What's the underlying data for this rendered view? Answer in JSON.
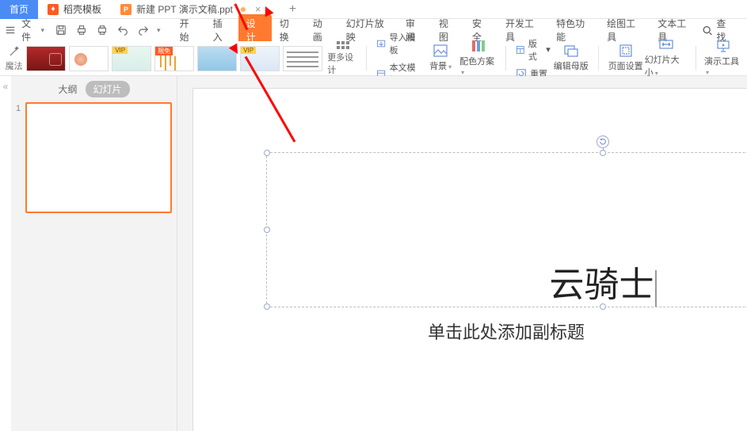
{
  "tabs": {
    "home": "首页",
    "docer": "稻壳模板",
    "file": "新建 PPT 演示文稿.ppt"
  },
  "file_menu": "文件",
  "menus": [
    "开始",
    "插入",
    "设计",
    "切换",
    "动画",
    "幻灯片放映",
    "审阅",
    "视图",
    "安全",
    "开发工具",
    "特色功能",
    "绘图工具",
    "文本工具"
  ],
  "active_menu": 2,
  "search": "查找",
  "ribbon": {
    "magic": "魔法",
    "more_design": "更多设计",
    "import_tpl": "导入模板",
    "this_tpl": "本文模板",
    "background": "背景",
    "color_scheme": "配色方案",
    "layout": "版式",
    "reset": "重置",
    "edit_master": "编辑母版",
    "page_setup": "页面设置",
    "slide_size": "幻灯片大小",
    "present_tools": "演示工具"
  },
  "sidebar": {
    "outline": "大纲",
    "slides": "幻灯片",
    "slide_number": "1"
  },
  "slide": {
    "title": "云骑士",
    "subtitle": "单击此处添加副标题"
  }
}
